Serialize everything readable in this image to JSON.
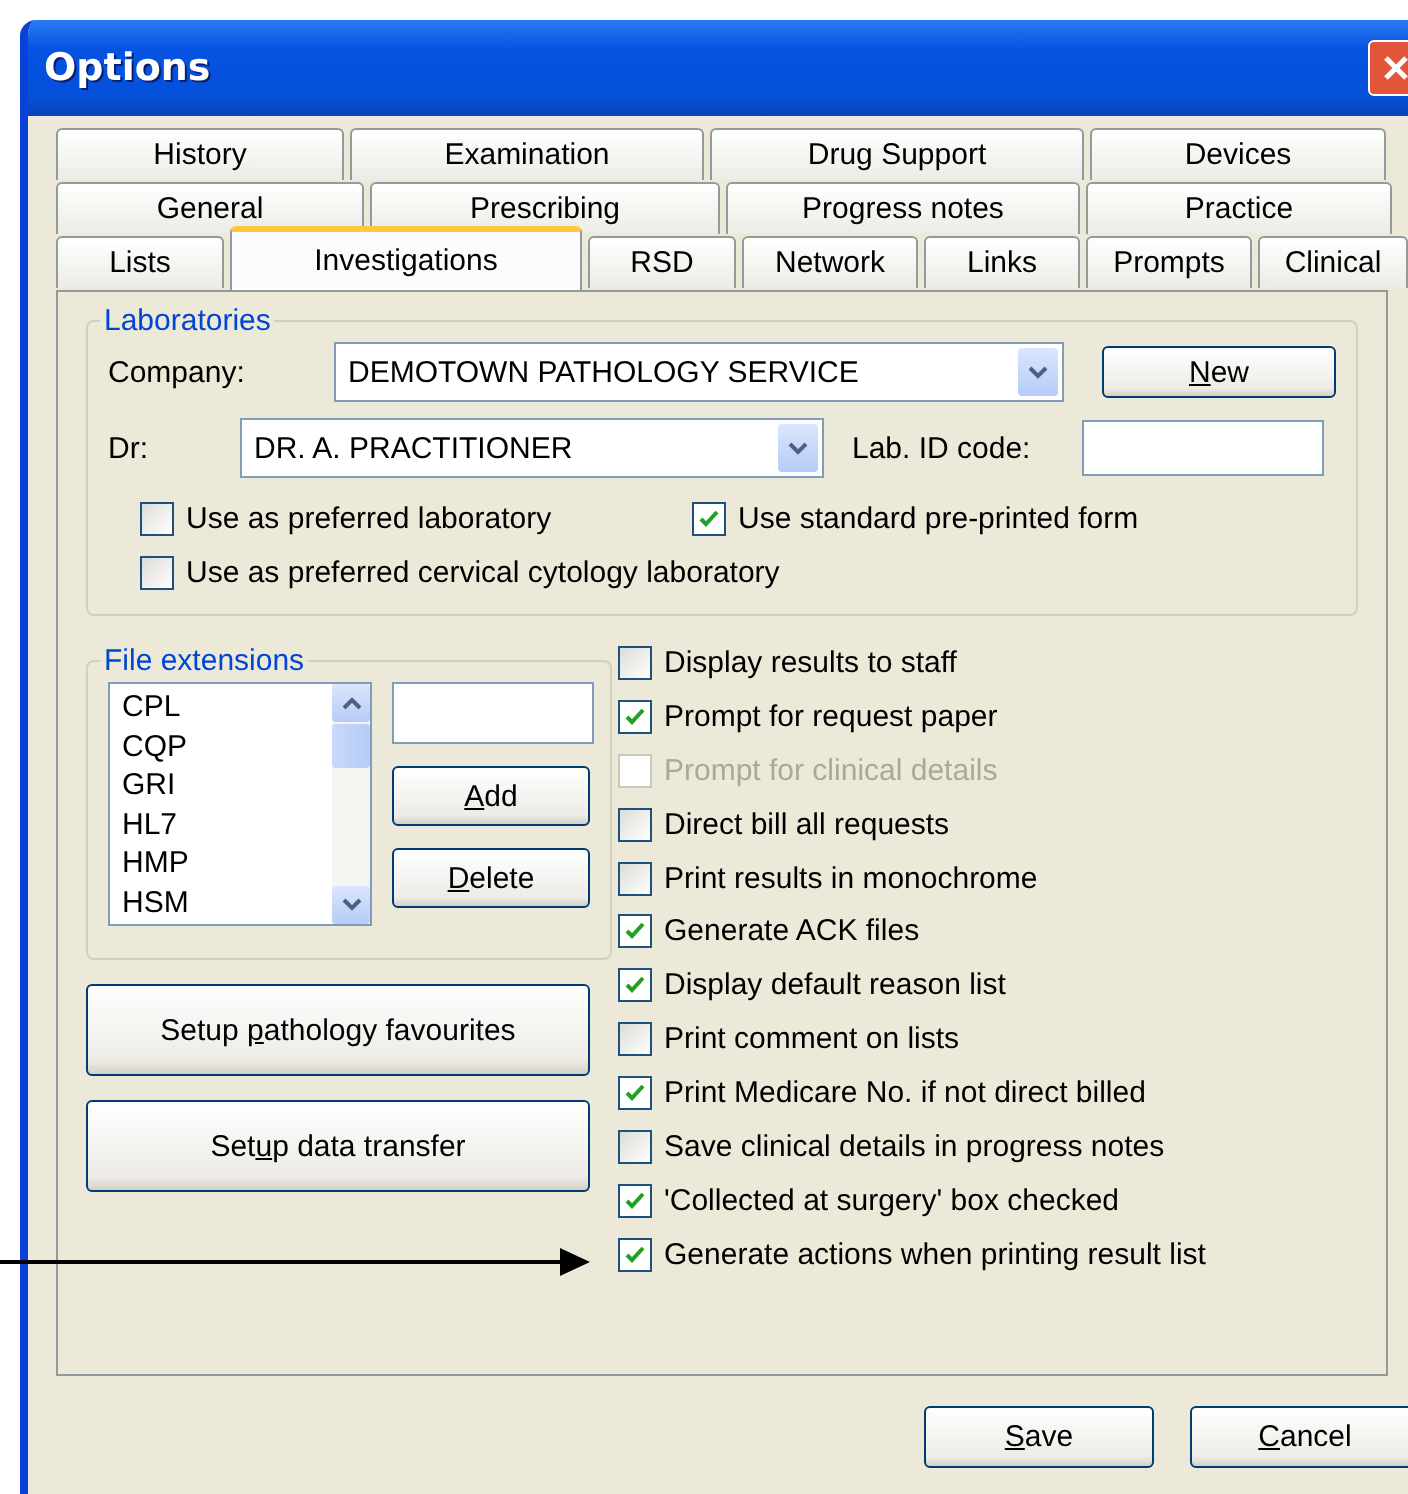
{
  "window": {
    "title": "Options"
  },
  "tab_rows": [
    {
      "tabs": [
        {
          "label": "History",
          "selected": false
        },
        {
          "label": "Examination",
          "selected": false
        },
        {
          "label": "Drug Support",
          "selected": false
        },
        {
          "label": "Devices",
          "selected": false
        }
      ]
    },
    {
      "tabs": [
        {
          "label": "General",
          "selected": false
        },
        {
          "label": "Prescribing",
          "selected": false
        },
        {
          "label": "Progress notes",
          "selected": false
        },
        {
          "label": "Practice",
          "selected": false
        }
      ]
    },
    {
      "tabs": [
        {
          "label": "Lists",
          "selected": false
        },
        {
          "label": "Investigations",
          "selected": true
        },
        {
          "label": "RSD",
          "selected": false
        },
        {
          "label": "Network",
          "selected": false
        },
        {
          "label": "Links",
          "selected": false
        },
        {
          "label": "Prompts",
          "selected": false
        },
        {
          "label": "Clinical",
          "selected": false
        }
      ]
    }
  ],
  "laboratories": {
    "title": "Laboratories",
    "company_label": "Company:",
    "company": "DEMOTOWN PATHOLOGY SERVICE",
    "new_button": {
      "key": "N",
      "post": "ew"
    },
    "dr_label": "Dr:",
    "dr": "DR. A. PRACTITIONER",
    "lab_id_label": "Lab. ID code:",
    "options": [
      {
        "label": "Use as preferred laboratory",
        "checked": false
      },
      {
        "label": "Use standard pre-printed form",
        "checked": true
      },
      {
        "label": "Use as preferred cervical cytology laboratory",
        "checked": false
      }
    ]
  },
  "file_extensions": {
    "title": "File extensions",
    "items": [
      "CPL",
      "CQP",
      "GRI",
      "HL7",
      "HMP",
      "HSM"
    ],
    "add_button": {
      "key": "A",
      "post": "dd"
    },
    "delete_button": {
      "key": "D",
      "post": "elete"
    }
  },
  "setup_buttons": [
    {
      "pre": "Setup ",
      "key": "p",
      "post": "athology favourites"
    },
    {
      "pre": "Set",
      "key": "u",
      "post": "p data transfer"
    }
  ],
  "settings": [
    {
      "label": "Display results to staff",
      "checked": false,
      "disabled": false
    },
    {
      "label": "Prompt for request paper",
      "checked": true,
      "disabled": false
    },
    {
      "label": "Prompt for clinical details",
      "checked": false,
      "disabled": true
    },
    {
      "label": "Direct bill all requests",
      "checked": false,
      "disabled": false
    },
    {
      "label": "Print results in monochrome",
      "checked": false,
      "disabled": false
    },
    {
      "label": "Generate ACK files",
      "checked": true,
      "disabled": false
    },
    {
      "label": "Display default reason list",
      "checked": true,
      "disabled": false
    },
    {
      "label": "Print comment on lists",
      "checked": false,
      "disabled": false
    },
    {
      "label": "Print Medicare No. if not direct billed",
      "checked": true,
      "disabled": false
    },
    {
      "label": "Save clinical details in progress notes",
      "checked": false,
      "disabled": false
    },
    {
      "label": "'Collected at surgery' box checked",
      "checked": true,
      "disabled": false
    },
    {
      "label": "Generate actions when printing result list",
      "checked": true,
      "disabled": false
    }
  ],
  "footer_buttons": [
    {
      "key": "S",
      "post": "ave"
    },
    {
      "key": "C",
      "post": "ancel"
    }
  ]
}
